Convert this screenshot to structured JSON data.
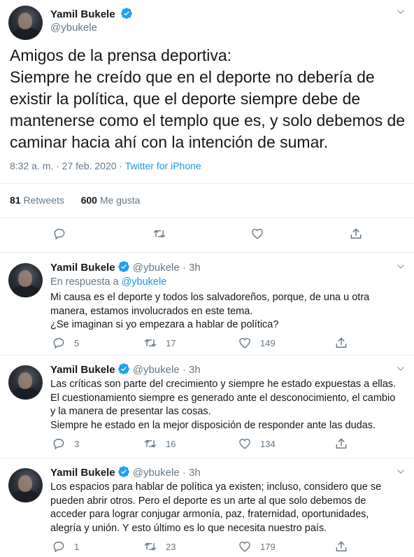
{
  "main_tweet": {
    "author_name": "Yamil Bukele",
    "author_handle": "@ybukele",
    "lines": [
      "Amigos de la prensa deportiva:",
      "Siempre he creído que en el deporte no debería de",
      "existir la política, que el deporte siempre debe de",
      "mantenerse como el templo que es, y solo debemos de",
      "caminar hacia ahí con la intención de sumar."
    ],
    "timestamp": "8:32 a. m. · 27 feb. 2020",
    "separator": " · ",
    "source": "Twitter for iPhone",
    "retweets_count": "81",
    "retweets_label": "Retweets",
    "likes_count": "600",
    "likes_label": "Me gusta"
  },
  "replies": [
    {
      "author_name": "Yamil Bukele",
      "author_handle": "@ybukele",
      "time": "· 3h",
      "in_reply_prefix": "En respuesta a",
      "in_reply_handle": "@ybukele",
      "lines": [
        "Mi causa es el deporte y todos los salvadoreños, porque, de una u otra",
        "manera, estamos involucrados en este tema.",
        "¿Se imaginan si yo empezara a hablar de política?"
      ],
      "reply_count": "5",
      "retweet_count": "17",
      "like_count": "149"
    },
    {
      "author_name": "Yamil Bukele",
      "author_handle": "@ybukele",
      "time": "· 3h",
      "lines": [
        "Las críticas son parte del crecimiento y siempre he estado expuestas a ellas.",
        "El cuestionamiento siempre es generado ante el desconocimiento, el cambio",
        "y la manera de presentar las cosas.",
        "Siempre he estado en la mejor disposición de responder ante las dudas."
      ],
      "reply_count": "3",
      "retweet_count": "16",
      "like_count": "134"
    },
    {
      "author_name": "Yamil Bukele",
      "author_handle": "@ybukele",
      "time": "· 3h",
      "lines": [
        "Los espacios para hablar de política ya existen; incluso, considero que se",
        "pueden abrir otros. Pero el deporte es un arte al que solo debemos de",
        "acceder para lograr conjugar armonía, paz, fraternidad, oportunidades,",
        "alegría y unión. Y esto último es lo que necesita nuestro país."
      ],
      "reply_count": "1",
      "retweet_count": "23",
      "like_count": "179"
    }
  ],
  "colors": {
    "text": "#14171a",
    "secondary": "#657786",
    "link": "#1b95e0",
    "verified": "#1da1f2",
    "divider": "#e6ecf0"
  },
  "icons": [
    "verified-badge-icon",
    "chevron-down-icon",
    "reply-icon",
    "retweet-icon",
    "like-icon",
    "share-icon"
  ]
}
